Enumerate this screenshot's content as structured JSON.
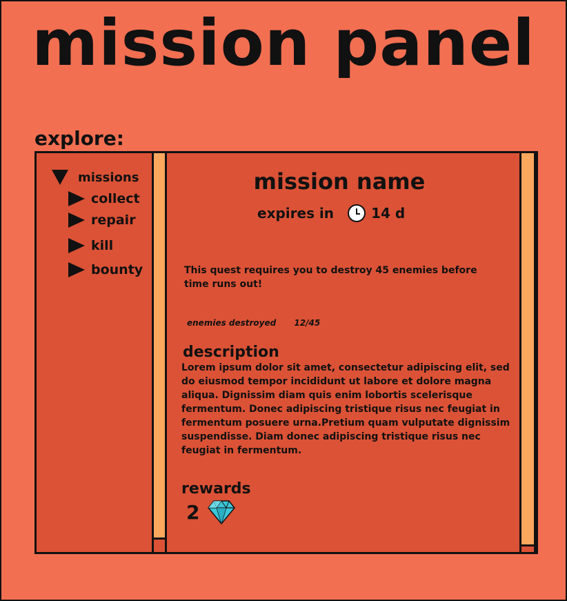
{
  "title": "mission panel",
  "explore_label": "explore:",
  "tree": {
    "root": "missions",
    "children": [
      "collect",
      "repair",
      "kill",
      "bounty"
    ]
  },
  "mission": {
    "name": "mission name",
    "expires_label": "expires in",
    "expires_value": "14 d",
    "quest_text": "This quest requires you to destroy 45 enemies before time runs out!",
    "progress_label": "enemies destroyed",
    "progress_value": "12/45",
    "description_heading": "description",
    "description_body": "Lorem ipsum dolor sit amet, consectetur adipiscing elit, sed do eiusmod tempor incididunt ut labore et dolore magna aliqua. Dignissim diam quis enim lobortis scelerisque fermentum. Donec adipiscing tristique risus nec feugiat in fermentum posuere urna.Pretium quam vulputate dignissim suspendisse. Diam donec adipiscing tristique risus nec feugiat in fermentum.",
    "rewards_heading": "rewards",
    "reward_count": "2",
    "reward_icon": "diamond-gem-icon"
  },
  "colors": {
    "background": "#F26F52",
    "panel": "#DC5236",
    "scrollbar_thumb": "#FBA75E",
    "gem": "#3CC6D8"
  }
}
